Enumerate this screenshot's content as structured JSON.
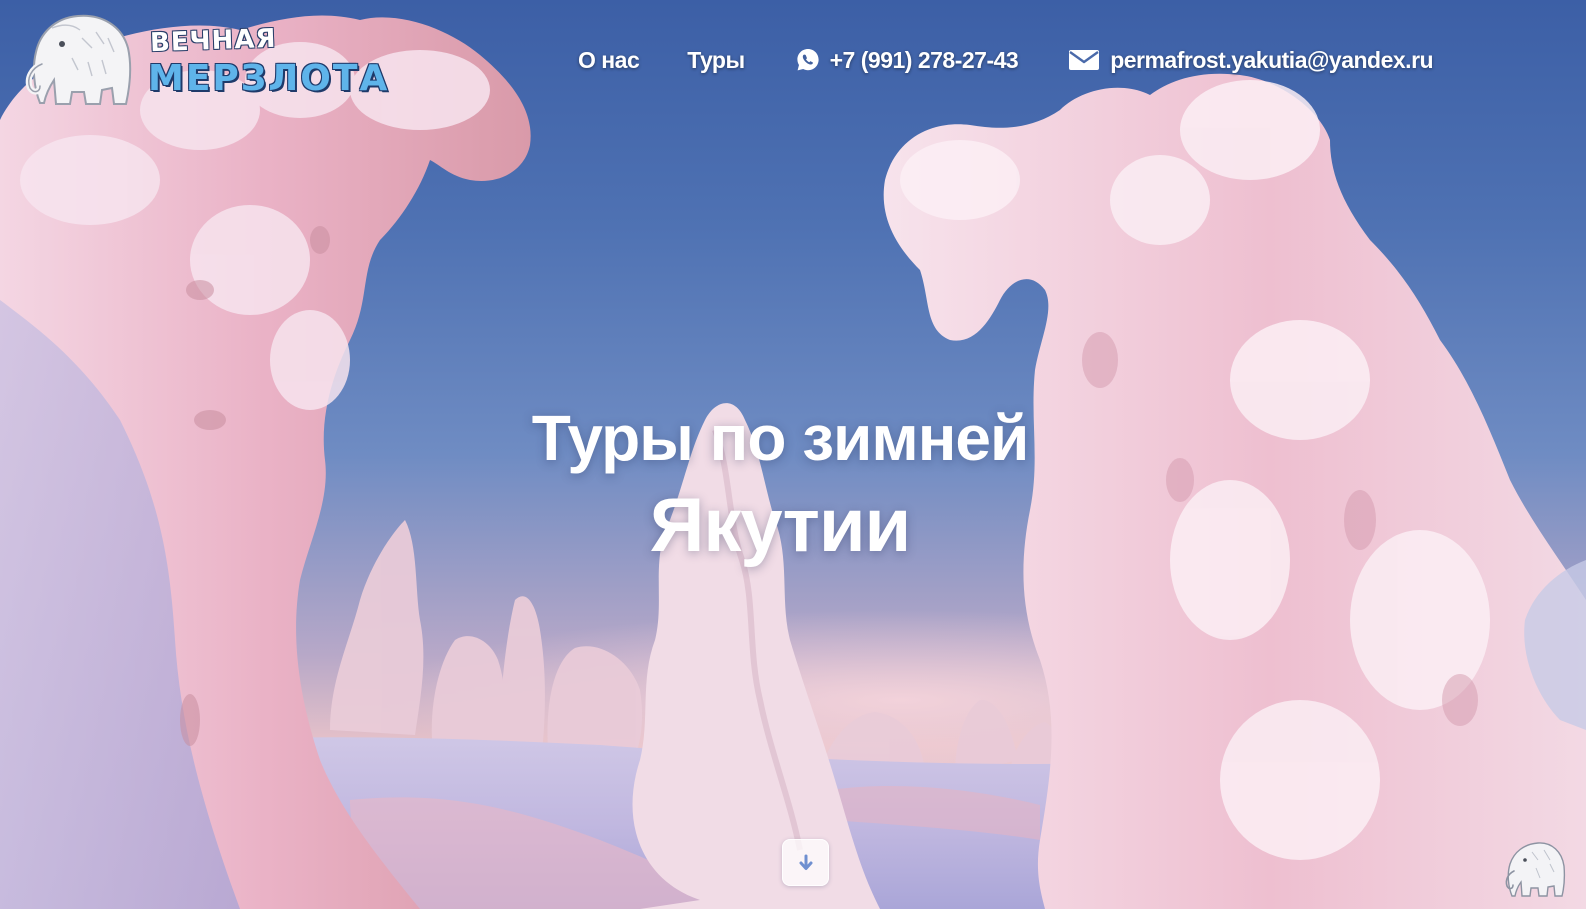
{
  "logo": {
    "line1": "ВЕЧНАЯ",
    "line2": "МЕРЗЛОТА",
    "icon": "mammoth-icon"
  },
  "nav": {
    "about": "О нас",
    "tours": "Туры",
    "phone": "+7 (991) 278-27-43",
    "phone_icon": "whatsapp-icon",
    "email": "permafrost.yakutia@yandex.ru",
    "email_icon": "envelope-icon"
  },
  "hero": {
    "title_line1": "Туры по зимней",
    "title_line2": "Якутии"
  },
  "scroll_button": {
    "icon": "arrow-down-icon"
  },
  "corner_badge": {
    "icon": "mammoth-icon"
  },
  "colors": {
    "sky_top": "#3c5fa6",
    "sky_horizon": "#e7c2c9",
    "logo_accent": "#5fb4ea",
    "text": "#ffffff"
  }
}
